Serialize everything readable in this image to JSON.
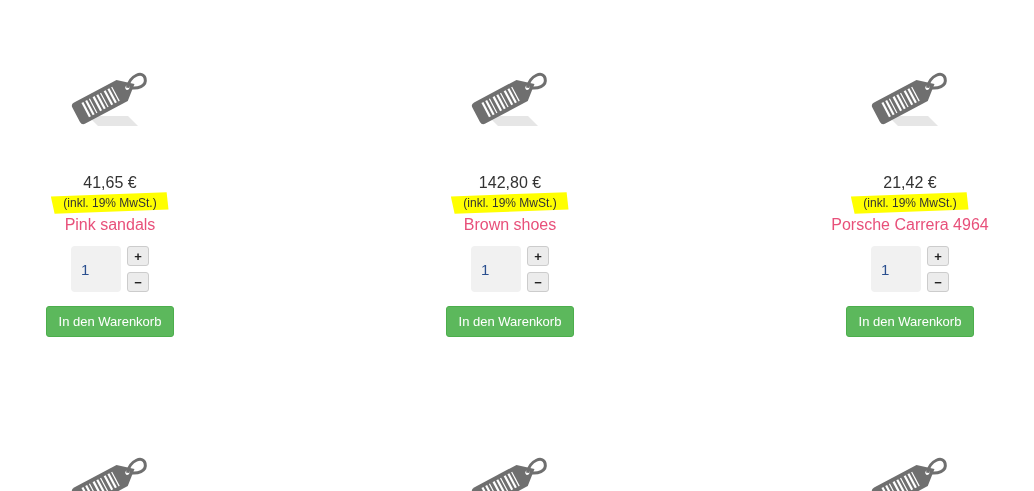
{
  "products": [
    {
      "kind": "full",
      "price": "41,65 €",
      "tax_note": "(inkl. 19% MwSt.)",
      "tax_highlighted": true,
      "name": "Pink sandals",
      "quantity": "1",
      "plus": "+",
      "minus": "−",
      "button": "In den Warenkorb"
    },
    {
      "kind": "full",
      "price": "142,80 €",
      "tax_note": "(inkl. 19% MwSt.)",
      "tax_highlighted": true,
      "name": "Brown shoes",
      "quantity": "1",
      "plus": "+",
      "minus": "−",
      "button": "In den Warenkorb"
    },
    {
      "kind": "full",
      "price": "21,42 €",
      "tax_note": "(inkl. 19% MwSt.)",
      "tax_highlighted": true,
      "name": "Porsche Carrera 4964",
      "quantity": "1",
      "plus": "+",
      "minus": "−",
      "button": "In den Warenkorb"
    },
    {
      "kind": "image_only"
    },
    {
      "kind": "image_only"
    },
    {
      "kind": "image_only"
    }
  ]
}
